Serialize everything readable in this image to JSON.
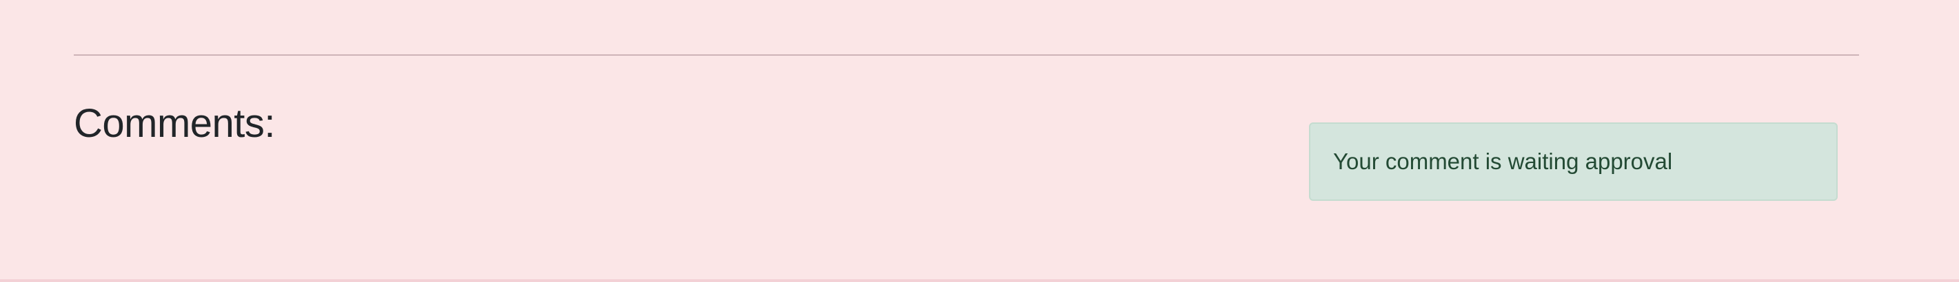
{
  "comments": {
    "heading": "Comments:",
    "status_message": "Your comment is waiting approval"
  },
  "colors": {
    "page_background": "#fbe6e7",
    "alert_background": "#d4e5dd",
    "alert_text": "#234a34",
    "heading_text": "#212529"
  }
}
